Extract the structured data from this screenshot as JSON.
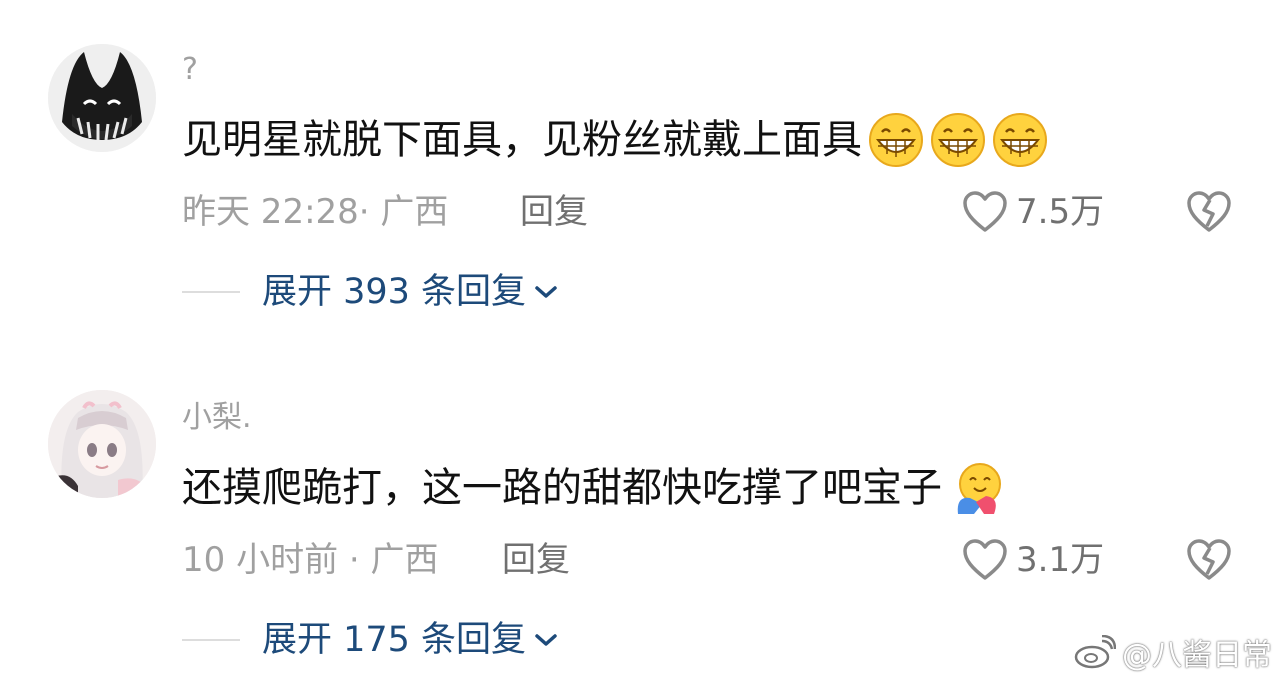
{
  "comments": [
    {
      "username": "?",
      "content": "见明星就脱下面具，见粉丝就戴上面具",
      "emojis": [
        "grin-emoji",
        "grin-emoji",
        "grin-emoji"
      ],
      "time": "昨天 22:28",
      "location": "广西",
      "meta_sep": "·",
      "reply_label": "回复",
      "likes": "7.5万",
      "expand_label": "展开 393 条回复"
    },
    {
      "username": "小梨.",
      "content": "还摸爬跪打，这一路的甜都快吃撑了吧宝子",
      "emojis": [
        "hug-emoji"
      ],
      "time": "10 小时前",
      "location": "广西",
      "meta_sep": "·",
      "reply_label": "回复",
      "likes": "3.1万",
      "expand_label": "展开 175 条回复"
    }
  ],
  "watermark": {
    "text": "@八酱日常",
    "icon": "weibo-icon"
  },
  "colors": {
    "link_blue": "#1d4a7a",
    "meta_gray": "#a0a0a0",
    "text_dark": "#111111"
  }
}
